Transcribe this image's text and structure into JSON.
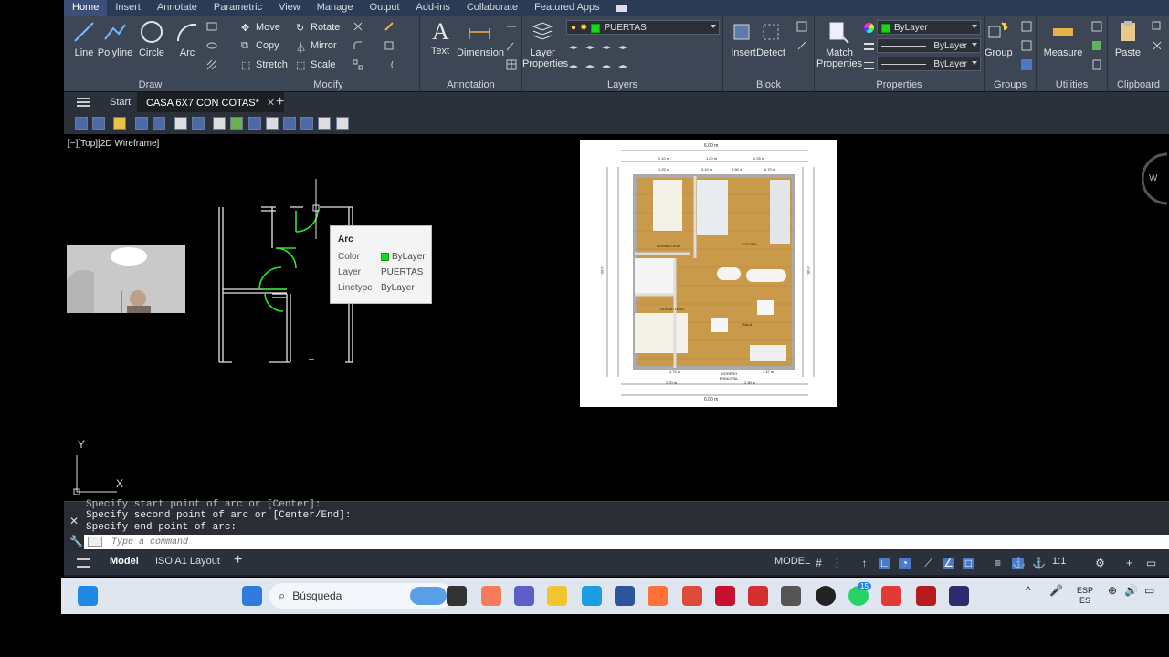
{
  "menubar": [
    "Home",
    "Insert",
    "Annotate",
    "Parametric",
    "View",
    "Manage",
    "Output",
    "Add-ins",
    "Collaborate",
    "Featured Apps"
  ],
  "ribbon": {
    "draw": {
      "title": "Draw",
      "line": "Line",
      "polyline": "Polyline",
      "circle": "Circle",
      "arc": "Arc"
    },
    "modify": {
      "title": "Modify",
      "move": "Move",
      "rotate": "Rotate",
      "copy": "Copy",
      "mirror": "Mirror",
      "stretch": "Stretch",
      "scale": "Scale"
    },
    "annotation": {
      "title": "Annotation",
      "text": "Text",
      "dimension": "Dimension"
    },
    "layers": {
      "title": "Layers",
      "layer_properties": "Layer Properties",
      "current_layer": "PUERTAS"
    },
    "block": {
      "title": "Block",
      "insert": "Insert",
      "detect": "Detect"
    },
    "properties": {
      "title": "Properties",
      "match": "Match Properties",
      "color": "ByLayer",
      "lineweight": "ByLayer",
      "linetype": "ByLayer"
    },
    "groups": {
      "title": "Groups",
      "group": "Group"
    },
    "utilities": {
      "title": "Utilities",
      "measure": "Measure"
    },
    "clipboard": {
      "title": "Clipboard",
      "paste": "Paste"
    }
  },
  "tabs": {
    "start": "Start",
    "file": "CASA 6X7.CON COTAS*"
  },
  "viewport_label": "[−][Top][2D Wireframe]",
  "tooltip": {
    "title": "Arc",
    "rows": [
      {
        "label": "Color",
        "value": "ByLayer"
      },
      {
        "label": "Layer",
        "value": "PUERTAS"
      },
      {
        "label": "Linetype",
        "value": "ByLayer"
      }
    ]
  },
  "plan": {
    "top_total": "6.00 m",
    "bottom_total": "6.00 m",
    "left_total": "7.00 m",
    "right_total": "7.00 m",
    "top_dims": [
      "2.10 m",
      "1.00 m",
      "2.25 m"
    ],
    "top_sub_dims": [
      "1.25 m",
      "0.10 m",
      "0.50 m",
      "0.70 m"
    ],
    "bottom_dims": [
      "1.70 m",
      "1.47 m"
    ],
    "bottom_sub_dims": [
      "2.70 m",
      "2.90 m"
    ],
    "rooms": [
      "DORMITORIO",
      "COCINA",
      "DORMITORIO",
      "SALA",
      "INGRESO PRINCIPAL"
    ]
  },
  "ucs": {
    "x": "X",
    "y": "Y"
  },
  "command": {
    "line0": "Specify start point of arc or [Center]:",
    "line1": "Specify second point of arc or [Center/End]:",
    "line2": "Specify end point of arc:",
    "placeholder": "Type a command"
  },
  "status": {
    "model_tab": "Model",
    "layout_tab": "ISO A1 Layout",
    "model_label": "MODEL",
    "scale": "1:1"
  },
  "taskbar": {
    "search": "Búsqueda",
    "lang": "ESP",
    "region": "ES",
    "badge": "15"
  }
}
